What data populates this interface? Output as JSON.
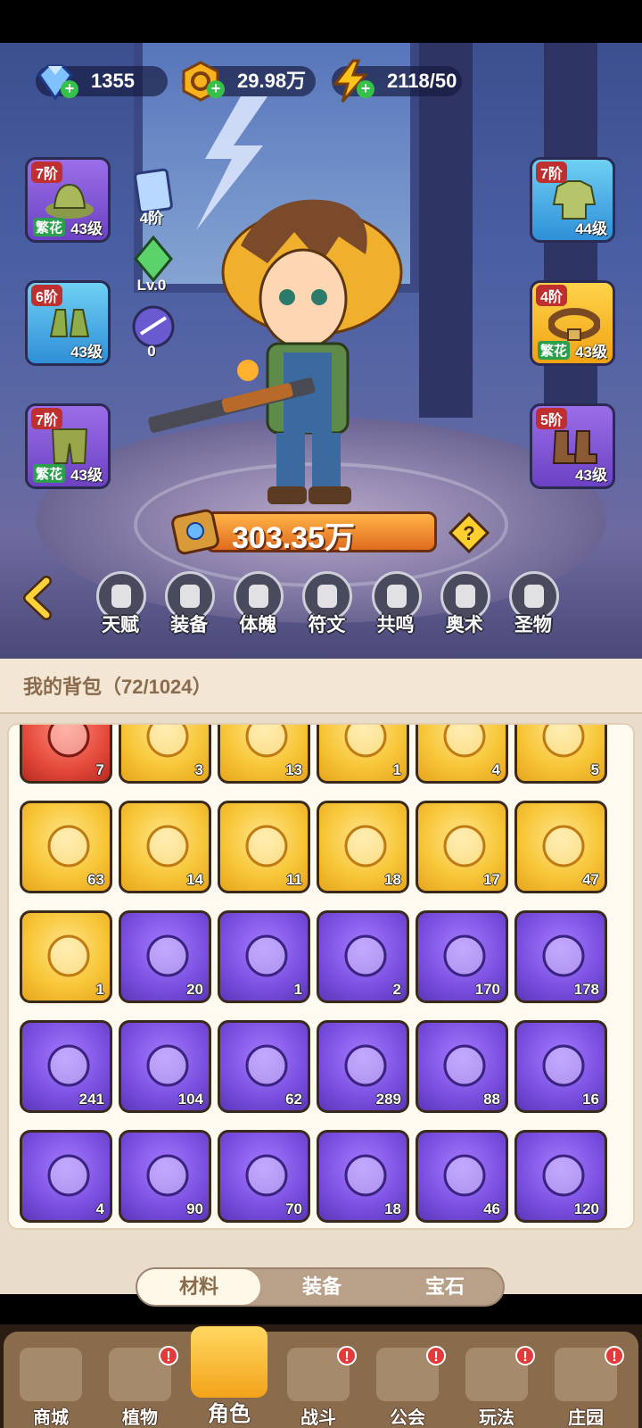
{
  "resources": {
    "gems": "1355",
    "gold": "29.98万",
    "energy": "2118/50"
  },
  "equipment_left": [
    {
      "rank": "7阶",
      "level": "43级",
      "tag": "繁花"
    },
    {
      "rank": "6阶",
      "level": "43级",
      "tag": ""
    },
    {
      "rank": "7阶",
      "level": "43级",
      "tag": "繁花"
    }
  ],
  "equipment_right": [
    {
      "rank": "7阶",
      "level": "44级",
      "tag": ""
    },
    {
      "rank": "4阶",
      "level": "43级",
      "tag": "繁花"
    },
    {
      "rank": "5阶",
      "level": "43级",
      "tag": ""
    }
  ],
  "stats": {
    "card_rank": "4阶",
    "gem_level": "Lv.0",
    "orb_count": "0"
  },
  "power": "303.35万",
  "tabs": [
    "天赋",
    "装备",
    "体魄",
    "符文",
    "共鸣",
    "奥术",
    "圣物"
  ],
  "bag": {
    "title": "我的背包（72/1024）",
    "rows": [
      [
        "7",
        "3",
        "13",
        "1",
        "4",
        "5"
      ],
      [
        "63",
        "14",
        "11",
        "18",
        "17",
        "47"
      ],
      [
        "1",
        "20",
        "1",
        "2",
        "170",
        "178"
      ],
      [
        "241",
        "104",
        "62",
        "289",
        "88",
        "16"
      ],
      [
        "4",
        "90",
        "70",
        "18",
        "46",
        "120"
      ]
    ]
  },
  "segment": [
    "材料",
    "装备",
    "宝石"
  ],
  "nav": [
    "商城",
    "植物",
    "角色",
    "战斗",
    "公会",
    "玩法",
    "庄园"
  ]
}
